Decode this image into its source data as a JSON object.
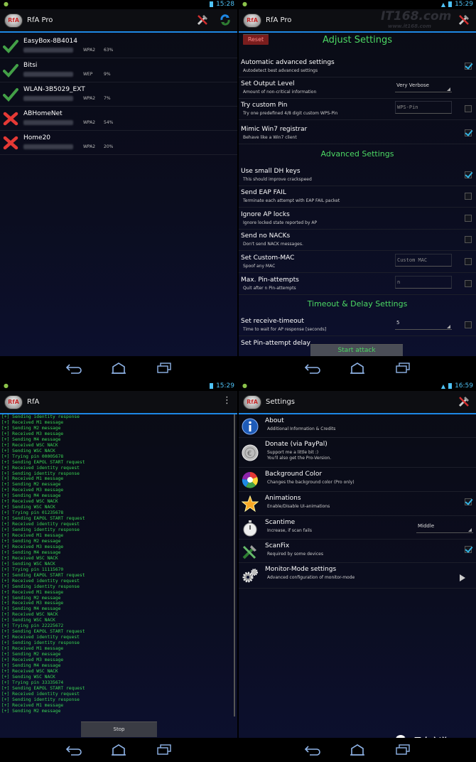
{
  "status": {
    "p1_time": "15:28",
    "p2_time": "15:29",
    "p3_time": "15:29",
    "p4_time": "16:59"
  },
  "app": {
    "title_pro": "RfA Pro",
    "title_plain": "RfA",
    "title_settings": "Settings",
    "logo_text": "RfA"
  },
  "wifi_list": [
    {
      "ssid": "EasyBox-8B4014",
      "enc": "WPA2",
      "pct": "63%",
      "ok": true
    },
    {
      "ssid": "Bitsi",
      "enc": "WEP",
      "pct": "9%",
      "ok": true
    },
    {
      "ssid": "WLAN-3B5029_EXT",
      "enc": "WPA2",
      "pct": "7%",
      "ok": true
    },
    {
      "ssid": "ABHomeNet",
      "enc": "WPA2",
      "pct": "54%",
      "ok": false
    },
    {
      "ssid": "Home20",
      "enc": "WPA2",
      "pct": "20%",
      "ok": false
    }
  ],
  "adjust": {
    "reset_label": "Reset",
    "heading": "Adjust Settings",
    "advanced_heading": "Advanced Settings",
    "timeout_heading": "Timeout & Delay Settings",
    "rows": [
      {
        "title": "Automatic advanced settings",
        "sub": "Autodetect best advanced settings",
        "checked": true
      },
      {
        "title": "Set Output Level",
        "sub": "Amount of non-critical information",
        "spinner": "Very Verbose"
      },
      {
        "title": "Try custom Pin",
        "sub": "Try one predefined 4/8 digit custom WPS-Pin",
        "input": "WPS-Pin",
        "checked": false
      },
      {
        "title": "Mimic Win7 registrar",
        "sub": "Behave like a Win7 client",
        "checked": true
      },
      {
        "title": "Use small DH keys",
        "sub": "This should improve crackspeed",
        "checked": true
      },
      {
        "title": "Send EAP FAIL",
        "sub": "Terminate each attempt with EAP FAIL packet",
        "checked": false
      },
      {
        "title": "Ignore AP locks",
        "sub": "Ignore locked state reported by AP",
        "checked": false
      },
      {
        "title": "Send no NACKs",
        "sub": "Don't send NACK messages.",
        "checked": false
      },
      {
        "title": "Set Custom-MAC",
        "sub": "Spoof any MAC",
        "input": "Custom MAC",
        "checked": false
      },
      {
        "title": "Max. Pin-attempts",
        "sub": "Quit after n Pin-attempts",
        "input": "n",
        "checked": false
      },
      {
        "title": "Set receive-timeout",
        "sub": "Time to wait for AP response [seconds]",
        "spinner": "5",
        "checked": false
      },
      {
        "title": "Set Pin-attempt delay",
        "sub": ""
      }
    ],
    "start_label": "Start attack"
  },
  "log_lines": [
    "[+] Sending identity response",
    "[+] Received M1 message",
    "[+] Sending M2 message",
    "[+] Received M3 message",
    "[+] Sending M4 message",
    "[+] Received WSC NACK",
    "[+] Sending WSC NACK",
    "[+] Trying pin 00005678",
    "[+] Sending EAPOL START request",
    "[+] Received identity request",
    "[+] Sending identity response",
    "[+] Received M1 message",
    "[+] Sending M2 message",
    "[+] Received M3 message",
    "[+] Sending M4 message",
    "[+] Received WSC NACK",
    "[+] Sending WSC NACK",
    "[+] Trying pin 01235678",
    "[+] Sending EAPOL START request",
    "[+] Received identity request",
    "[+] Sending identity response",
    "[+] Received M1 message",
    "[+] Sending M2 message",
    "[+] Received M3 message",
    "[+] Sending M4 message",
    "[+] Received WSC NACK",
    "[+] Sending WSC NACK",
    "[+] Trying pin 11115670",
    "[+] Sending EAPOL START request",
    "[+] Received identity request",
    "[+] Sending identity response",
    "[+] Received M1 message",
    "[+] Sending M2 message",
    "[+] Received M3 message",
    "[+] Sending M4 message",
    "[+] Received WSC NACK",
    "[+] Sending WSC NACK",
    "[+] Trying pin 22225672",
    "[+] Sending EAPOL START request",
    "[+] Received identity request",
    "[+] Sending identity response",
    "[+] Received M1 message",
    "[+] Sending M2 message",
    "[+] Received M3 message",
    "[+] Sending M4 message",
    "[+] Received WSC NACK",
    "[+] Sending WSC NACK",
    "[+] Trying pin 33335674",
    "[+] Sending EAPOL START request",
    "[+] Received identity request",
    "[+] Sending identity response",
    "[+] Received M1 message",
    "[+] Sending M2 message"
  ],
  "stop_label": "Stop",
  "settings": [
    {
      "title": "About",
      "sub": "Additional Information & Credits",
      "icon": "info-icon"
    },
    {
      "title": "Donate (via PayPal)",
      "sub": "Support me a little bit :)",
      "sub2": "You'll also get the Pro-Version.",
      "icon": "coin-icon"
    },
    {
      "title": "Background Color",
      "sub": "Changes the background color (Pro only)",
      "icon": "color-wheel-icon"
    },
    {
      "title": "Animations",
      "sub": "Enable/Disable UI-animations",
      "icon": "star-icon",
      "checked": true
    },
    {
      "title": "Scantime",
      "sub": "Increase, if scan fails",
      "icon": "stopwatch-icon",
      "spinner": "Middle"
    },
    {
      "title": "ScanFix",
      "sub": "Required by some devices",
      "icon": "tools-icon",
      "checked": true
    },
    {
      "title": "Monitor-Mode settings",
      "sub": "Advanced configuration of monitor-mode",
      "icon": "gears-icon",
      "arrow": true
    }
  ],
  "watermarks": {
    "top": "IT168.com",
    "top_url": "www.it168.com",
    "bottom": "黑白之道"
  }
}
